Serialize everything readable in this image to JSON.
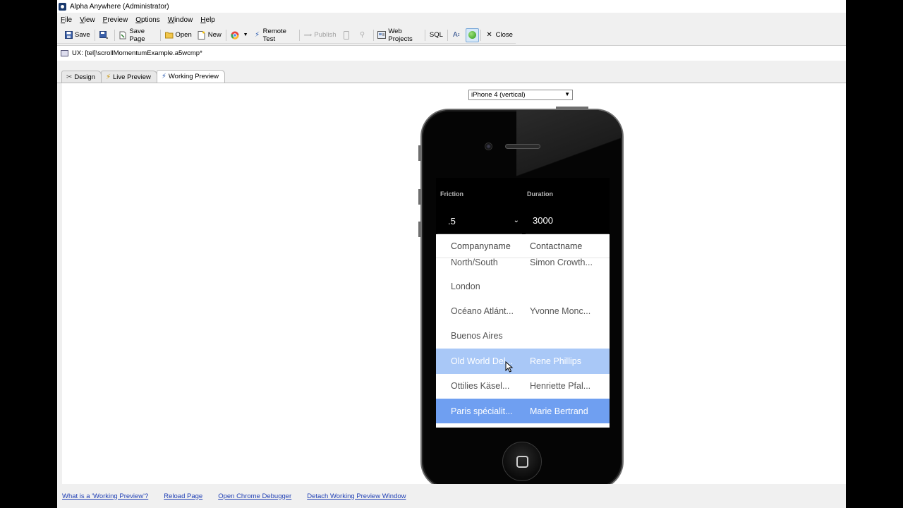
{
  "window": {
    "title": "Alpha Anywhere (Administrator)"
  },
  "menu": [
    "File",
    "View",
    "Preview",
    "Options",
    "Window",
    "Help"
  ],
  "toolbar": {
    "save": "Save",
    "save_page": "Save Page",
    "open": "Open",
    "new": "New",
    "remote_test": "Remote Test",
    "publish": "Publish",
    "web_projects": "Web Projects",
    "sql": "SQL",
    "close": "Close"
  },
  "path": {
    "text": "UX: [tel]\\scrollMomentumExample.a5wcmp*"
  },
  "tabs": [
    {
      "label": "Design",
      "icon": "wrench-icon"
    },
    {
      "label": "Live Preview",
      "icon": "lightning-icon"
    },
    {
      "label": "Working Preview",
      "icon": "lightning-icon",
      "selected": true
    }
  ],
  "device": {
    "selected": "iPhone 4 (vertical)"
  },
  "app_screen": {
    "friction_label": "Friction",
    "duration_label": "Duration",
    "friction_value": ".5",
    "duration_value": "3000",
    "columns": [
      "Companyname",
      "Contactname"
    ],
    "rows": [
      {
        "company": "North/South",
        "contact": "Simon Crowth...",
        "state": "normal"
      },
      {
        "company": "London",
        "contact": "",
        "state": "normal"
      },
      {
        "company": "Océano Atlánt...",
        "contact": "Yvonne Monc...",
        "state": "normal"
      },
      {
        "company": "Buenos Aires",
        "contact": "",
        "state": "normal"
      },
      {
        "company": "Old World Del...",
        "contact": "Rene Phillips",
        "state": "highlight-light"
      },
      {
        "company": "Ottilies Käsel...",
        "contact": "Henriette Pfal...",
        "state": "normal"
      },
      {
        "company": "Paris spécialit...",
        "contact": "Marie Bertrand",
        "state": "highlight-dark"
      }
    ]
  },
  "footer_links": [
    "What is a 'Working Preview'?",
    "Reload Page",
    "Open Chrome Debugger",
    "Detach Working Preview Window"
  ],
  "colors": {
    "row_highlight_light": "#a9c8f7",
    "row_highlight_dark": "#6f9ff1",
    "link": "#1f3fb5"
  }
}
